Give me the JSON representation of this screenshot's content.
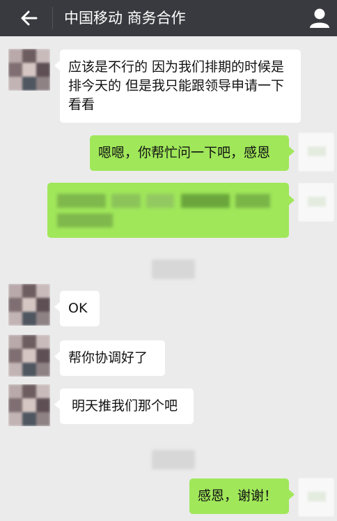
{
  "header": {
    "title": "中国移动 商务合作",
    "back_icon": "arrow-left-icon",
    "contact_icon": "person-icon"
  },
  "messages": [
    {
      "from": "other",
      "text": "应该是不行的 因为我们排期的时候是排今天的 但是我只能跟领导申请一下看看"
    },
    {
      "from": "me",
      "text": "嗯嗯，你帮忙问一下吧，感恩"
    },
    {
      "from": "me",
      "text": "",
      "blurred": true
    },
    {
      "from": "other",
      "text": "OK"
    },
    {
      "from": "other",
      "text": "帮你协调好了"
    },
    {
      "from": "other",
      "text": "明天推我们那个吧"
    },
    {
      "from": "me",
      "text": "感恩，谢谢！"
    }
  ],
  "colors": {
    "header_bg": "#393a3f",
    "chat_bg": "#ebebeb",
    "my_bubble": "#a0e75a",
    "other_bubble": "#ffffff"
  }
}
